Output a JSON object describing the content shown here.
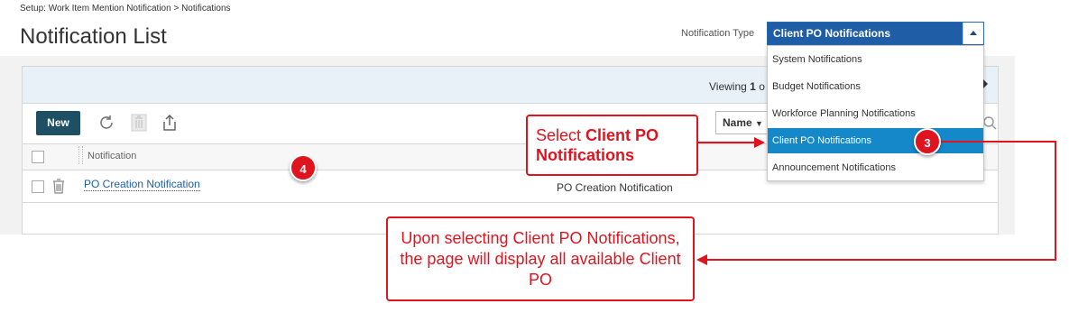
{
  "breadcrumb": "Setup: Work Item Mention Notification > Notifications",
  "page_title": "Notification List",
  "notification_type": {
    "label": "Notification Type",
    "selected": "Client PO Notifications",
    "options": [
      "System Notifications",
      "Budget Notifications",
      "Workforce Planning Notifications",
      "Client PO Notifications",
      "Announcement Notifications"
    ]
  },
  "toolbar": {
    "viewing_prefix": "Viewing",
    "viewing_count": "1",
    "viewing_suffix": "o",
    "new_label": "New",
    "sort_label": "Name"
  },
  "table": {
    "column_notification": "Notification",
    "rows": [
      {
        "name": "PO Creation Notification",
        "description": "PO Creation Notification"
      }
    ]
  },
  "annotations": {
    "callout_select_prefix": "Select ",
    "callout_select_bold": "Client PO Notifications",
    "callout_upon": "Upon selecting Client PO Notifications, the page will display all available Client PO",
    "badge_3": "3",
    "badge_4": "4"
  },
  "colors": {
    "accent": "#1f5da6",
    "selected_item": "#1588c9",
    "annotation_red": "#e0141e",
    "new_button": "#1f4f63",
    "link": "#1a5fa8"
  }
}
